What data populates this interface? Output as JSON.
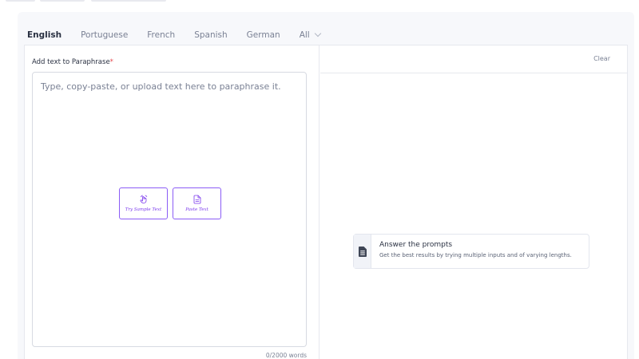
{
  "tabs": [
    {
      "label": "English",
      "active": true
    },
    {
      "label": "Portuguese",
      "active": false
    },
    {
      "label": "French",
      "active": false
    },
    {
      "label": "Spanish",
      "active": false
    },
    {
      "label": "German",
      "active": false
    },
    {
      "label": "All",
      "active": false
    }
  ],
  "input": {
    "label": "Add text to Paraphrase",
    "required_mark": "*",
    "placeholder": "Type, copy-paste, or upload text here to paraphrase it.",
    "word_count": "0/2000 words"
  },
  "actions": {
    "sample_label": "Try Sample Text",
    "paste_label": "Paste Text"
  },
  "output": {
    "clear_label": "Clear"
  },
  "tip": {
    "title": "Answer the prompts",
    "subtitle": "Get the best results by trying multiple inputs and of varying lengths."
  },
  "colors": {
    "accent": "#8b5cf6",
    "required": "#e5484d"
  },
  "icons": {
    "sample": "hand-tap-icon",
    "paste": "document-icon",
    "tip": "document-list-icon",
    "all_dropdown": "chevron-down-icon"
  }
}
